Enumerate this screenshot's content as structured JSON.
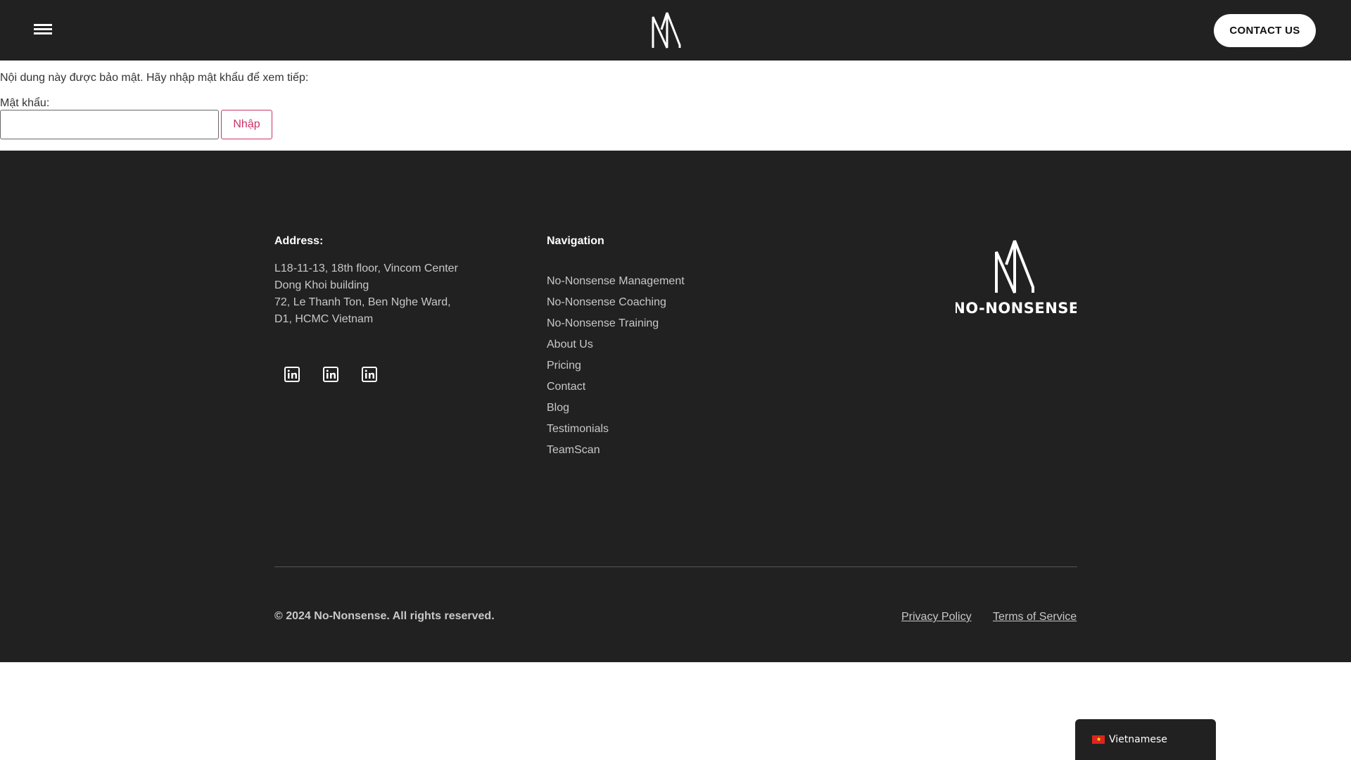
{
  "header": {
    "contact_label": "CONTACT US"
  },
  "protected": {
    "message": "Nội dung này được bảo mật. Hãy nhập mật khẩu để xem tiếp:",
    "password_label": "Mật khẩu:",
    "password_value": "",
    "submit_label": "Nhập"
  },
  "footer": {
    "address": {
      "title": "Address:",
      "lines": [
        "L18-11-13, 18th floor, Vincom Center",
        "Dong Khoi building",
        "72, Le Thanh Ton, Ben Nghe Ward,",
        "D1, HCMC Vietnam"
      ]
    },
    "social_icons": [
      "linkedin-icon",
      "linkedin-icon",
      "linkedin-icon"
    ],
    "navigation": {
      "title": "Navigation",
      "items": [
        "No-Nonsense Management",
        "No-Nonsense Coaching",
        "No-Nonsense Training",
        "About Us",
        "Pricing",
        "Contact",
        "Blog",
        "Testimonials",
        "TeamScan"
      ]
    },
    "brand_text": "NO-NONSENSE",
    "copyright": "© 2024 No-Nonsense. All rights reserved.",
    "privacy_label": "Privacy Policy",
    "terms_label": "Terms of Service"
  },
  "language": {
    "label": "Vietnamese"
  },
  "colors": {
    "dark_bg": "#212121",
    "accent": "#cc3366",
    "text_muted": "#c8c8c8"
  }
}
